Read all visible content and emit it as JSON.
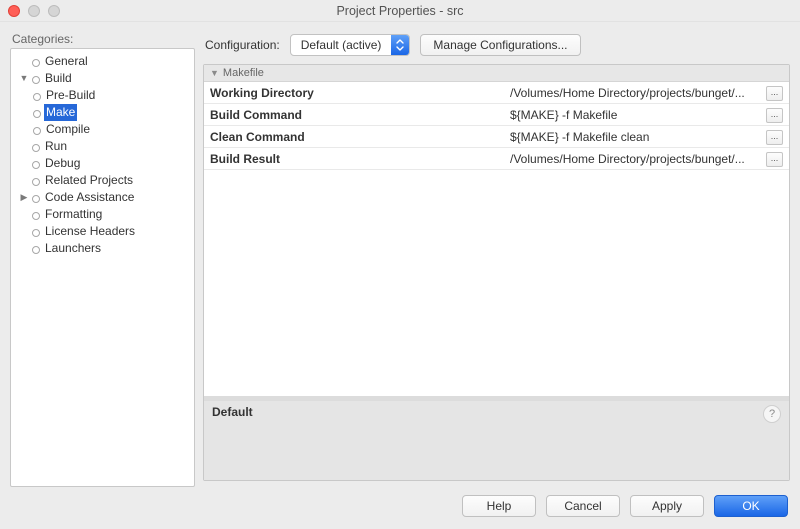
{
  "window": {
    "title": "Project Properties - src"
  },
  "sidebar": {
    "label": "Categories:",
    "items": [
      {
        "label": "General",
        "expandable": false
      },
      {
        "label": "Build",
        "expandable": true,
        "expanded": true,
        "children": [
          {
            "label": "Pre-Build"
          },
          {
            "label": "Make",
            "selected": true
          },
          {
            "label": "Compile"
          }
        ]
      },
      {
        "label": "Run",
        "expandable": false
      },
      {
        "label": "Debug",
        "expandable": false
      },
      {
        "label": "Related Projects",
        "expandable": false
      },
      {
        "label": "Code Assistance",
        "expandable": true,
        "expanded": false
      },
      {
        "label": "Formatting",
        "expandable": false
      },
      {
        "label": "License Headers",
        "expandable": false
      },
      {
        "label": "Launchers",
        "expandable": false
      }
    ]
  },
  "config": {
    "label": "Configuration:",
    "value": "Default (active)",
    "manage": "Manage Configurations..."
  },
  "section": {
    "title": "Makefile"
  },
  "props": [
    {
      "key": "Working Directory",
      "value": "/Volumes/Home Directory/projects/bunget/...",
      "browse": true
    },
    {
      "key": "Build Command",
      "value": "${MAKE} -f Makefile",
      "browse": true
    },
    {
      "key": "Clean Command",
      "value": "${MAKE} -f Makefile clean",
      "browse": true
    },
    {
      "key": "Build Result",
      "value": "/Volumes/Home Directory/projects/bunget/...",
      "browse": true
    }
  ],
  "desc": {
    "title": "Default"
  },
  "footer": {
    "help": "Help",
    "cancel": "Cancel",
    "apply": "Apply",
    "ok": "OK"
  }
}
